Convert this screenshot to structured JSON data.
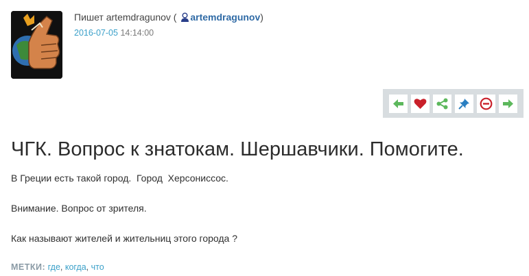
{
  "post": {
    "author_prefix": "Пишет artemdragunov (",
    "author_username": "artemdragunov",
    "author_suffix": ")",
    "date": "2016-07-05",
    "time": "14:14:00",
    "title": "ЧГК. Вопрос к знатокам. Шершавчики. Помогите.",
    "paragraphs": [
      "В Греции есть такой город.  Город  Херсониссос.",
      "Внимание. Вопрос от зрителя.",
      "Как называют жителей и жительниц этого города ?"
    ],
    "tags_label": "МЕТКИ:",
    "tags": [
      "где",
      "когда",
      "что"
    ]
  },
  "toolbar": {
    "icons": [
      "arrow-left-icon",
      "heart-icon",
      "share-icon",
      "pin-icon",
      "minus-circle-icon",
      "arrow-right-icon"
    ]
  },
  "colors": {
    "link": "#2f6aa5",
    "date": "#3aa0c9",
    "green": "#5cb85c",
    "heart": "#c9202a",
    "pin": "#2a7fc1",
    "toolbar_bg": "#d8dde0"
  }
}
